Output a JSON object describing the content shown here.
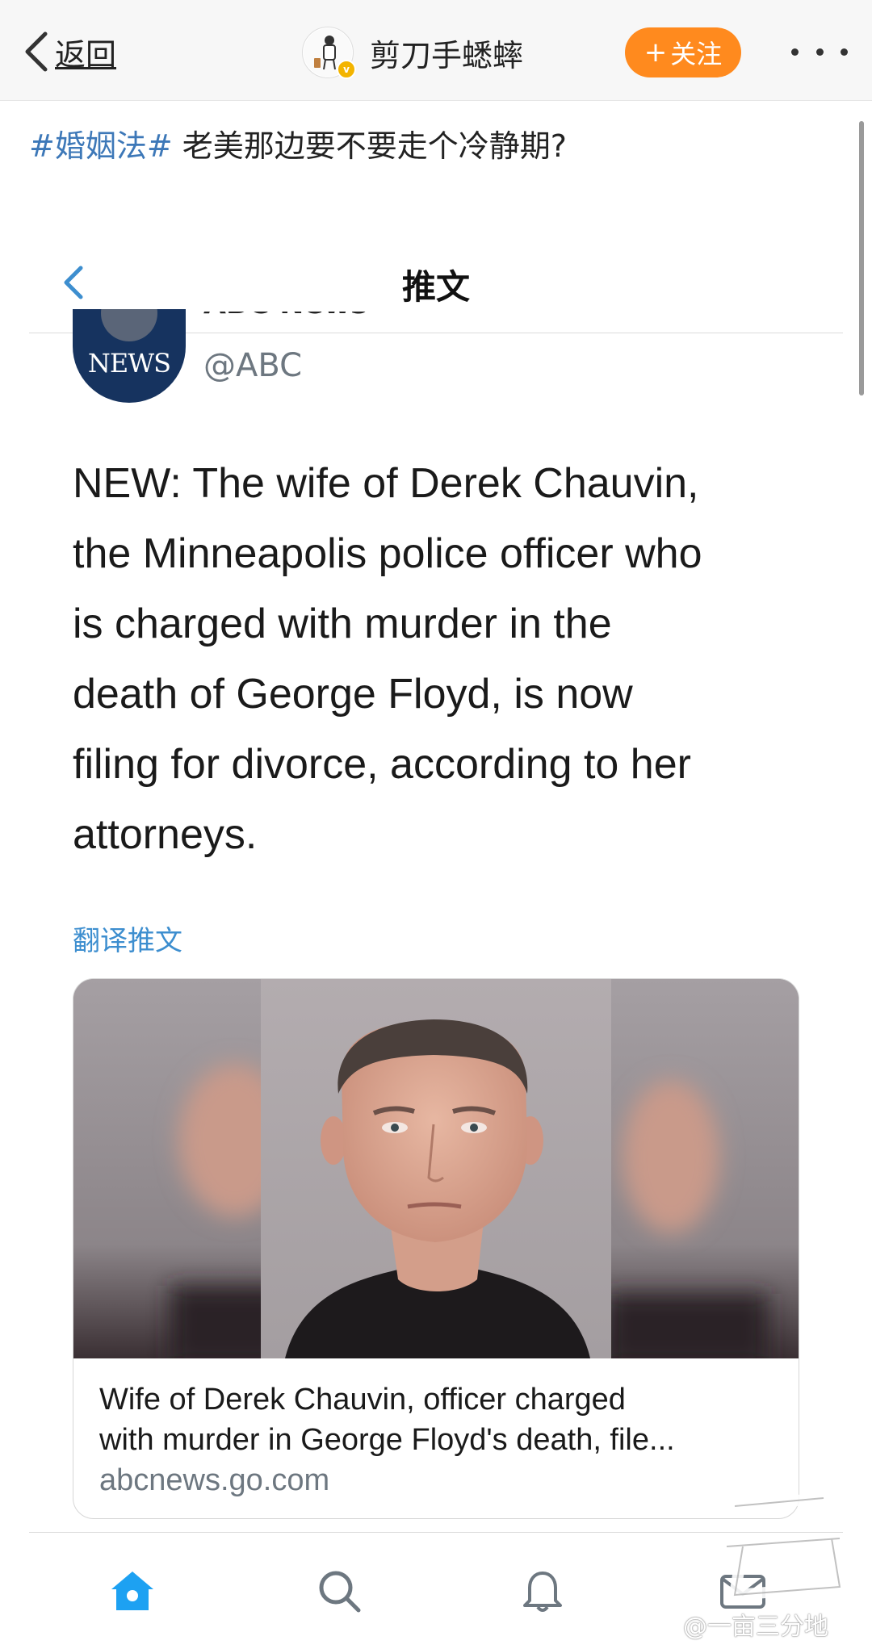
{
  "topbar": {
    "back_label": "返回",
    "username": "剪刀手蟋蟀",
    "follow_label": "关注",
    "colors": {
      "follow_bg": "#ff8a1e",
      "verified": "#f3b400"
    }
  },
  "post": {
    "topic": "#婚姻法#",
    "text": " 老美那边要不要走个冷静期?"
  },
  "tweet_screen": {
    "title": "推文",
    "account_name": "ABC News",
    "logo_word": "NEWS",
    "handle": "@ABC",
    "lines": [
      "NEW: The wife of Derek Chauvin,",
      "the Minneapolis police officer who",
      "is charged with murder in the",
      "death of George Floyd, is now",
      "filing for divorce, according to her",
      "attorneys."
    ],
    "translate_label": "翻译推文",
    "card": {
      "line1": "Wife of Derek Chauvin, officer charged",
      "line2": "with murder in George Floyd's death, file...",
      "domain": "abcnews.go.com"
    },
    "nav_icons": [
      "home-icon",
      "search-icon",
      "notifications-icon",
      "messages-icon"
    ],
    "accent_color": "#1da1f2"
  },
  "watermark": "@一亩三分地"
}
